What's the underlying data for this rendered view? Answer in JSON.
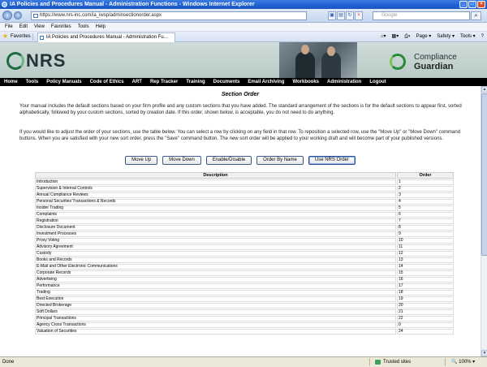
{
  "window": {
    "title": "IA Policies and Procedures Manual - Administration Functions - Windows Internet Explorer"
  },
  "addressbar": {
    "url": "https://www.nrs-inc.com/ia_iwsp/adminsectionorder.aspx",
    "search_placeholder": "Google"
  },
  "menu": [
    "File",
    "Edit",
    "View",
    "Favorites",
    "Tools",
    "Help"
  ],
  "favbar": {
    "favorites_label": "Favorites",
    "tab_title": "IA Policies and Procedures Manual - Administration Fu...",
    "commands": [
      "Page ▾",
      "Safety ▾",
      "Tools ▾",
      "?"
    ]
  },
  "brand": {
    "logo_text": "NRS",
    "product_line1": "Compliance",
    "product_line2": "Guardian"
  },
  "site_nav": [
    "Home",
    "Tools",
    "Policy Manuals",
    "Code of Ethics",
    "ART",
    "Rep Tracker",
    "Training",
    "Documents",
    "Email Archiving",
    "Workbooks",
    "Administration",
    "Logout"
  ],
  "page": {
    "title": "Section Order",
    "paragraph1": "Your manual includes the default sections based on your firm profile and any custom sections that you have added. The standard arrangement of the sections is for the default sections to appear first, sorted alphabetically, followed by your custom sections, sorted by creation date. If this order, shown below, is acceptable, you do not need to do anything.",
    "paragraph2": "If you would like to adjust the order of your sections, use the table below. You can select a row by clicking on any field in that row. To reposition a selected row, use the \"Move Up\" or \"Move Down\" command buttons. When you are satisfied with your new sort order, press the \"Save\" command button. The new sort order will be applied to your working draft and will become part of your published versions."
  },
  "buttons": {
    "move_up": "Move Up",
    "move_down": "Move Down",
    "enable_disable": "Enable/Disable",
    "order_by_name": "Order By Name",
    "use_nrs_order": "Use NRS Order"
  },
  "table": {
    "headers": {
      "description": "Description",
      "order": "Order"
    },
    "rows": [
      {
        "description": "Introduction",
        "order": "1"
      },
      {
        "description": "Supervision & Internal Controls",
        "order": "2"
      },
      {
        "description": "Annual Compliance Reviews",
        "order": "3"
      },
      {
        "description": "Personal Securities Transactions & Records",
        "order": "4"
      },
      {
        "description": "Insider Trading",
        "order": "5"
      },
      {
        "description": "Complaints",
        "order": "6"
      },
      {
        "description": "Registration",
        "order": "7"
      },
      {
        "description": "Disclosure Document",
        "order": "8"
      },
      {
        "description": "Investment Processes",
        "order": "9"
      },
      {
        "description": "Proxy Voting",
        "order": "10"
      },
      {
        "description": "Advisory Agreement",
        "order": "11"
      },
      {
        "description": "Custody",
        "order": "12"
      },
      {
        "description": "Books and Records",
        "order": "13"
      },
      {
        "description": "E-Mail and Other Electronic Communications",
        "order": "14"
      },
      {
        "description": "Corporate Records",
        "order": "15"
      },
      {
        "description": "Advertising",
        "order": "16"
      },
      {
        "description": "Performance",
        "order": "17"
      },
      {
        "description": "Trading",
        "order": "18"
      },
      {
        "description": "Best Execution",
        "order": "19"
      },
      {
        "description": "Directed Brokerage",
        "order": "20"
      },
      {
        "description": "Soft Dollars",
        "order": "21"
      },
      {
        "description": "Principal Transactions",
        "order": "22"
      },
      {
        "description": "Agency Cross Transactions",
        "order": "0"
      },
      {
        "description": "Valuation of Securities",
        "order": "24"
      }
    ]
  },
  "statusbar": {
    "status": "Done",
    "zone": "Trusted sites",
    "zoom": "100%"
  }
}
